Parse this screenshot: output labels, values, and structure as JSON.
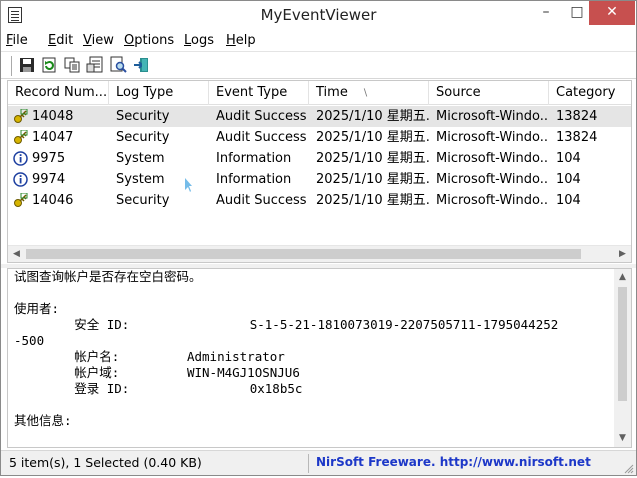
{
  "window": {
    "title": "MyEventViewer"
  },
  "menu": [
    {
      "label": "File",
      "ul": "F",
      "rest": "ile"
    },
    {
      "label": "Edit",
      "ul": "E",
      "rest": "dit"
    },
    {
      "label": "View",
      "ul": "V",
      "rest": "iew"
    },
    {
      "label": "Options",
      "ul": "O",
      "rest": "ptions"
    },
    {
      "label": "Logs",
      "ul": "L",
      "rest": "ogs"
    },
    {
      "label": "Help",
      "ul": "H",
      "rest": "elp"
    }
  ],
  "toolbar": {
    "icons": [
      "save-icon",
      "refresh-icon",
      "copy-icon",
      "properties-icon",
      "find-icon",
      "exit-icon"
    ]
  },
  "table": {
    "columns": [
      "Record Num...",
      "Log Type",
      "Event Type",
      "Time",
      "Source",
      "Category"
    ],
    "sort_column": "Time",
    "rows": [
      {
        "icon": "audit-success-icon",
        "record": "14048",
        "log_type": "Security",
        "event_type": "Audit Success",
        "time": "2025/1/10 星期五...",
        "source": "Microsoft-Windo...",
        "category": "13824",
        "selected": true
      },
      {
        "icon": "audit-success-icon",
        "record": "14047",
        "log_type": "Security",
        "event_type": "Audit Success",
        "time": "2025/1/10 星期五...",
        "source": "Microsoft-Windo...",
        "category": "13824",
        "selected": false
      },
      {
        "icon": "information-icon",
        "record": "9975",
        "log_type": "System",
        "event_type": "Information",
        "time": "2025/1/10 星期五...",
        "source": "Microsoft-Windo...",
        "category": "104",
        "selected": false
      },
      {
        "icon": "information-icon",
        "record": "9974",
        "log_type": "System",
        "event_type": "Information",
        "time": "2025/1/10 星期五...",
        "source": "Microsoft-Windo...",
        "category": "104",
        "selected": false
      },
      {
        "icon": "audit-success-icon",
        "record": "14046",
        "log_type": "Security",
        "event_type": "Audit Success",
        "time": "2025/1/10 星期五...",
        "source": "Microsoft-Windo...",
        "category": "104",
        "selected": false
      }
    ]
  },
  "details": {
    "lines": [
      "试图查询帐户是否存在空白密码。",
      "",
      "使用者:",
      "        安全 ID:                S-1-5-21-1810073019-2207505711-1795044252",
      "-500",
      "        帐户名:         Administrator",
      "        帐户域:         WIN-M4GJ1OSNJU6",
      "        登录 ID:                0x18b5c",
      "",
      "其他信息:"
    ]
  },
  "status": {
    "summary": "5 item(s), 1 Selected  (0.40 KB)",
    "link": "NirSoft Freeware.  http://www.nirsoft.net"
  },
  "colors": {
    "selected_row": "#e5e5e5",
    "link": "#1d38c8",
    "close_button": "#c7504f"
  }
}
